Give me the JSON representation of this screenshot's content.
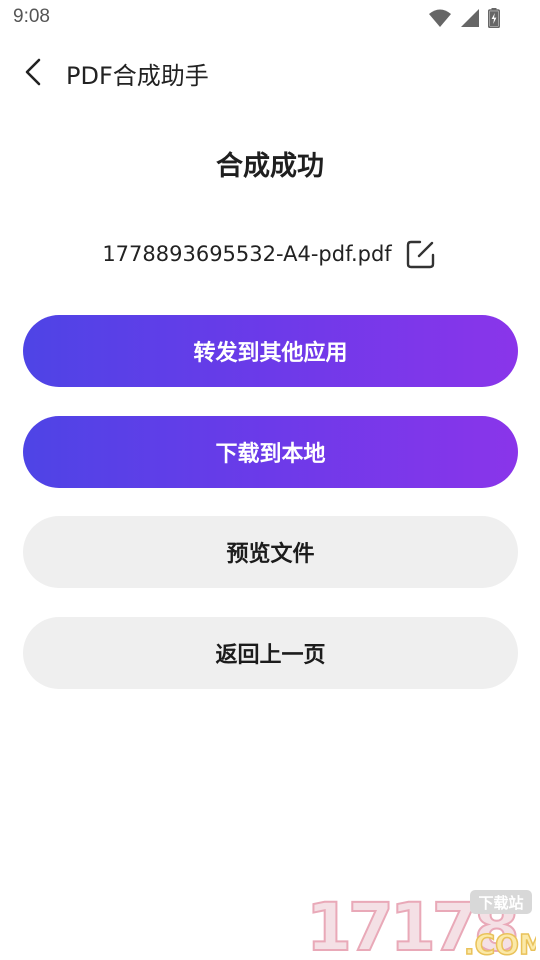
{
  "status_bar": {
    "time": "9:08",
    "icons": [
      "wifi-icon",
      "signal-icon",
      "battery-charging-icon"
    ]
  },
  "nav": {
    "title": "PDF合成助手",
    "back_icon": "chevron-left-icon"
  },
  "result": {
    "title": "合成成功",
    "file_name": "1778893695532-A4-pdf.pdf",
    "edit_icon": "edit-icon"
  },
  "buttons": {
    "forward": "转发到其他应用",
    "download": "下载到本地",
    "preview": "预览文件",
    "back": "返回上一页"
  },
  "watermark": {
    "number": "17178",
    "label": "下载站",
    "domain": ".COM"
  },
  "colors": {
    "gradient_start": "#4e44e6",
    "gradient_end": "#8a35ea",
    "secondary_bg": "#efefef",
    "text": "#1a1a1a"
  }
}
